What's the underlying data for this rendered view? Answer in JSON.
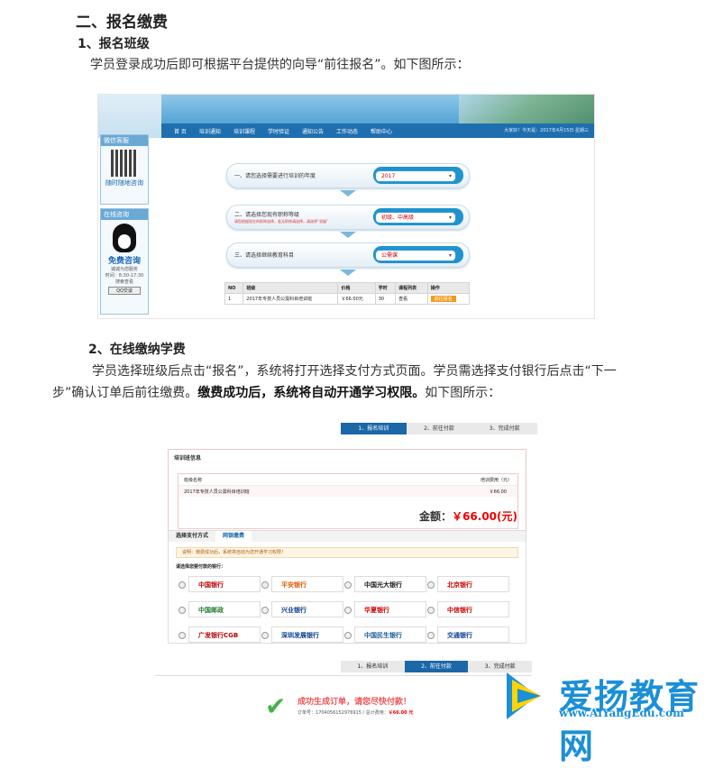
{
  "section_title": "二、报名缴费",
  "step1": {
    "heading": "1、报名班级",
    "text": "学员登录成功后即可根据平台提供的向导“前往报名”。如下图所示："
  },
  "screenshot1": {
    "nav": [
      "首 页",
      "培训通知",
      "培训课程",
      "学时验证",
      "通知公告",
      "工作动态",
      "帮助中心"
    ],
    "nav_info": "大家好！今天是：2017年4月15日 星期三",
    "side_wechat_title": "微信客服",
    "side_wechat_text": "随时随地咨询",
    "side_online_title": "在线咨询",
    "side_online_big": "免费咨询",
    "side_online_sub": "诚诚为您服务",
    "side_online_time": "时间：8:30-17:30",
    "side_online_extra": "搜索查看",
    "side_qq_button": "QQ交谈",
    "step_a_label": "一、请您选择需要进行培训的年度",
    "step_a_value": "2017",
    "step_b_label": "二、请选择您现有职称等级",
    "step_b_sub": "请您根据现在的职称选择，若无职称请选择，请选择“初级”",
    "step_b_value": "初级、中高级",
    "step_c_label": "三、请选择继续教育科目",
    "step_c_value": "公需课",
    "table_headers": [
      "NO",
      "班级",
      "价格",
      "学时",
      "课程列表",
      "操作"
    ],
    "table_row": [
      "1",
      "2017年专技人员公需科目培训班",
      "￥66.00元",
      "30",
      "查看",
      "前往报名"
    ]
  },
  "step2": {
    "heading": "2、在线缴纳学费",
    "text_a": "学员选择班级后点击“报名”，系统将打开选择支付方式页面。学员需选择支付银行后点击“下一",
    "text_b": "步”确认订单后前往缴费。",
    "text_bold": "缴费成功后，系统将自动开通学习权限。",
    "text_c": "如下图所示："
  },
  "screenshot2": {
    "steps": [
      "1、报名培训",
      "2、前往付款",
      "3、完成付款"
    ],
    "panel_title": "培训班信息",
    "col_name": "班级名称",
    "col_fee": "培训费用（元）",
    "row_name": "2017年专技人员公需科目培训班",
    "row_fee": "￥66.00",
    "amount_label": "金额：",
    "amount_value": "￥66.00(元)",
    "tab_pay": "选择支付方式",
    "tab_bank": "网银缴费",
    "note": "说明：缴费成功后，系统将自动为您开通学习权限！",
    "bank_prompt": "请选择您要付款的银行：",
    "banks": [
      "中国银行",
      "中国平安",
      "平安银行",
      "Bank",
      "中国光大银行",
      "北京银行",
      "中国邮政",
      "兴业银行",
      "华夏银行",
      "中信银行",
      "广发银行CGB",
      "深圳发展银行",
      "中国民生银行",
      "交通银行"
    ]
  },
  "screenshot3": {
    "steps": [
      "1、报名培训",
      "2、前往付款",
      "3、完成付款"
    ],
    "message": "成功生成订单，请您尽快付款！",
    "order_label": "订单号：",
    "order_no": "1704056152976915",
    "total_label": "/ 总计费用：",
    "total_value": "￥66.00 元"
  },
  "watermark": {
    "name": "爱扬教育网",
    "url": "www.AiYangEdu.com"
  }
}
